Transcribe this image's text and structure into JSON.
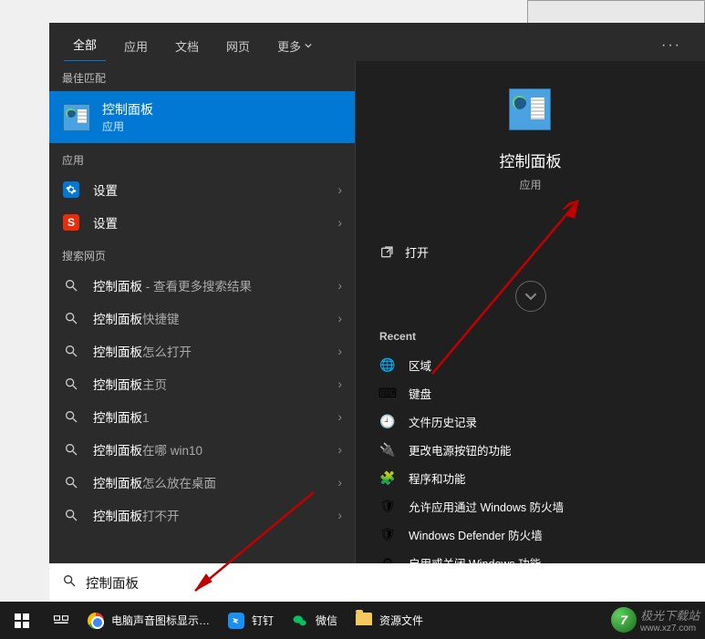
{
  "tabs": {
    "all": "全部",
    "apps": "应用",
    "docs": "文档",
    "web": "网页",
    "more": "更多"
  },
  "sections": {
    "best_match": "最佳匹配",
    "apps": "应用",
    "web": "搜索网页"
  },
  "best_match": {
    "title": "控制面板",
    "subtitle": "应用"
  },
  "app_results": [
    {
      "label": "设置"
    },
    {
      "label": "设置"
    }
  ],
  "web_results": [
    {
      "prefix": "控制面板",
      "suffix": " - 查看更多搜索结果"
    },
    {
      "prefix": "控制面板",
      "suffix": "快捷键"
    },
    {
      "prefix": "控制面板",
      "suffix": "怎么打开"
    },
    {
      "prefix": "控制面板",
      "suffix": "主页"
    },
    {
      "prefix": "控制面板",
      "suffix": "1"
    },
    {
      "prefix": "控制面板",
      "suffix": "在哪 win10"
    },
    {
      "prefix": "控制面板",
      "suffix": "怎么放在桌面"
    },
    {
      "prefix": "控制面板",
      "suffix": "打不开"
    }
  ],
  "preview": {
    "title": "控制面板",
    "subtitle": "应用",
    "open": "打开",
    "recent_header": "Recent",
    "recent": [
      "区域",
      "键盘",
      "文件历史记录",
      "更改电源按钮的功能",
      "程序和功能",
      "允许应用通过 Windows 防火墙",
      "Windows Defender 防火墙",
      "启用或关闭 Windows 功能"
    ]
  },
  "search_value": "控制面板",
  "taskbar": {
    "app1": "电脑声音图标显示…",
    "app2": "钉钉",
    "app3": "微信",
    "app4": "资源文件"
  },
  "watermark": {
    "name": "极光下载站",
    "url": "www.xz7.com"
  }
}
